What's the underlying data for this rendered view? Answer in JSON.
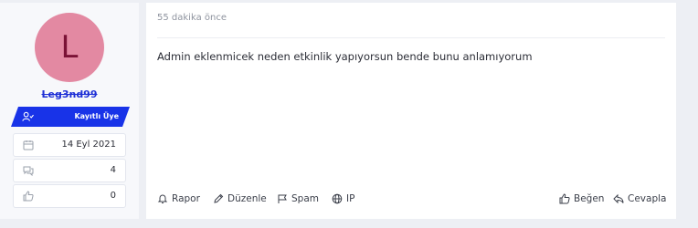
{
  "user": {
    "avatar_initial": "L",
    "username": "Leg3nd99",
    "role": "Kayıtlı Üye",
    "stats": [
      {
        "icon": "calendar-icon",
        "value": "14 Eyl 2021"
      },
      {
        "icon": "comments-icon",
        "value": "4"
      },
      {
        "icon": "thumbs-up-icon",
        "value": "0"
      }
    ]
  },
  "post": {
    "timestamp": "55 dakika önce",
    "message": "Admin eklenmicek neden etkinlik yapıyorsun bende bunu anlamıyorum",
    "actions": {
      "report": "Rapor",
      "edit": "Düzenle",
      "spam": "Spam",
      "ip": "IP",
      "like": "Beğen",
      "reply": "Cevapla"
    }
  },
  "colors": {
    "avatar_bg": "#e389a2",
    "avatar_text": "#7a1236",
    "username": "#1f30d6",
    "badge_bg": "#1833e8",
    "page_bg": "#edeff4"
  }
}
